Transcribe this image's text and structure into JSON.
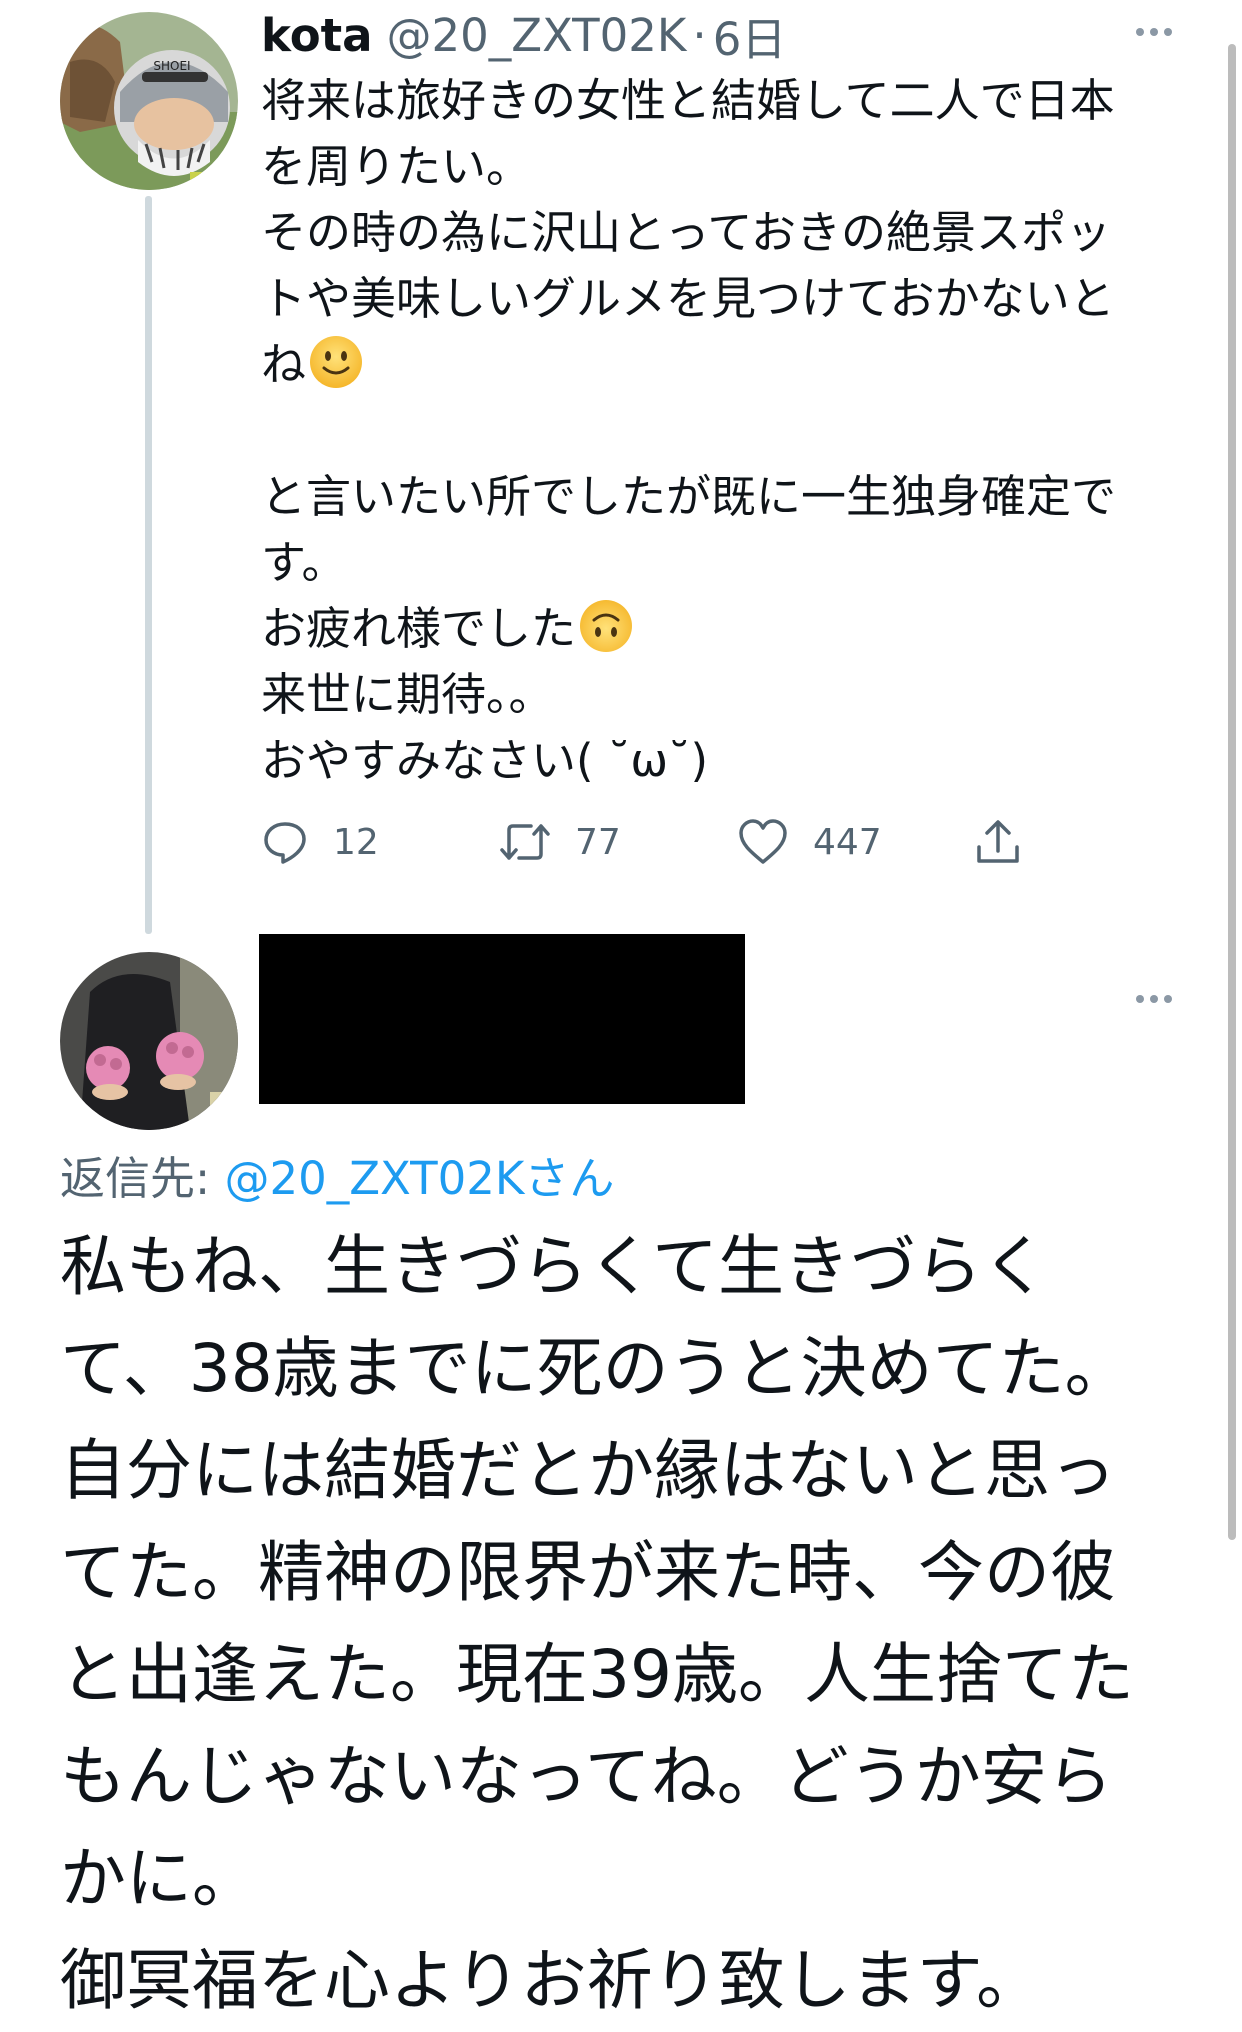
{
  "tweet": {
    "display_name": "kota",
    "handle": "@20_ZXT02K",
    "separator": "·",
    "time": "6日",
    "avatar_icon": "profile-photo-helmet-rider",
    "more_icon": "more-horizontal-icon",
    "lines": [
      "将来は旅好きの女性と結婚して二人で日本",
      "を周りたい。",
      "その時の為に沢山とっておきの絶景スポッ",
      "トや美味しいグルメを見つけておかないと",
      "ね",
      "と言いたい所でしたが既に一生独身確定で",
      "す。",
      "お疲れ様でした",
      "来世に期待。。",
      "おやすみなさい( ˘ω˘)"
    ],
    "emoji_1": "slightly-smiling-face-emoji",
    "emoji_2": "upside-down-face-emoji",
    "actions": {
      "reply_icon": "reply-icon",
      "reply_count": "12",
      "retweet_icon": "retweet-icon",
      "retweet_count": "77",
      "like_icon": "heart-icon",
      "like_count": "447",
      "share_icon": "share-icon"
    }
  },
  "reply": {
    "avatar_icon": "profile-photo-pink-gloves",
    "name_redacted": true,
    "more_icon": "more-horizontal-icon",
    "reply_to_label": "返信先: ",
    "reply_to_mention": "@20_ZXT02Kさん",
    "lines": [
      "私もね、生きづらくて生きづらく",
      "て、38歳までに死のうと決めてた。",
      "自分には結婚だとか縁はないと思っ",
      "てた。精神の限界が来た時、今の彼",
      "と出逢えた。現在39歳。人生捨てた",
      "もんじゃないなってね。どうか安ら",
      "かに。",
      "御冥福を心よりお祈り致します。"
    ]
  },
  "colors": {
    "text_primary": "#0f1419",
    "text_secondary": "#536471",
    "link": "#1d9bf0",
    "thread_line": "#cfd9de",
    "redaction": "#000000"
  }
}
